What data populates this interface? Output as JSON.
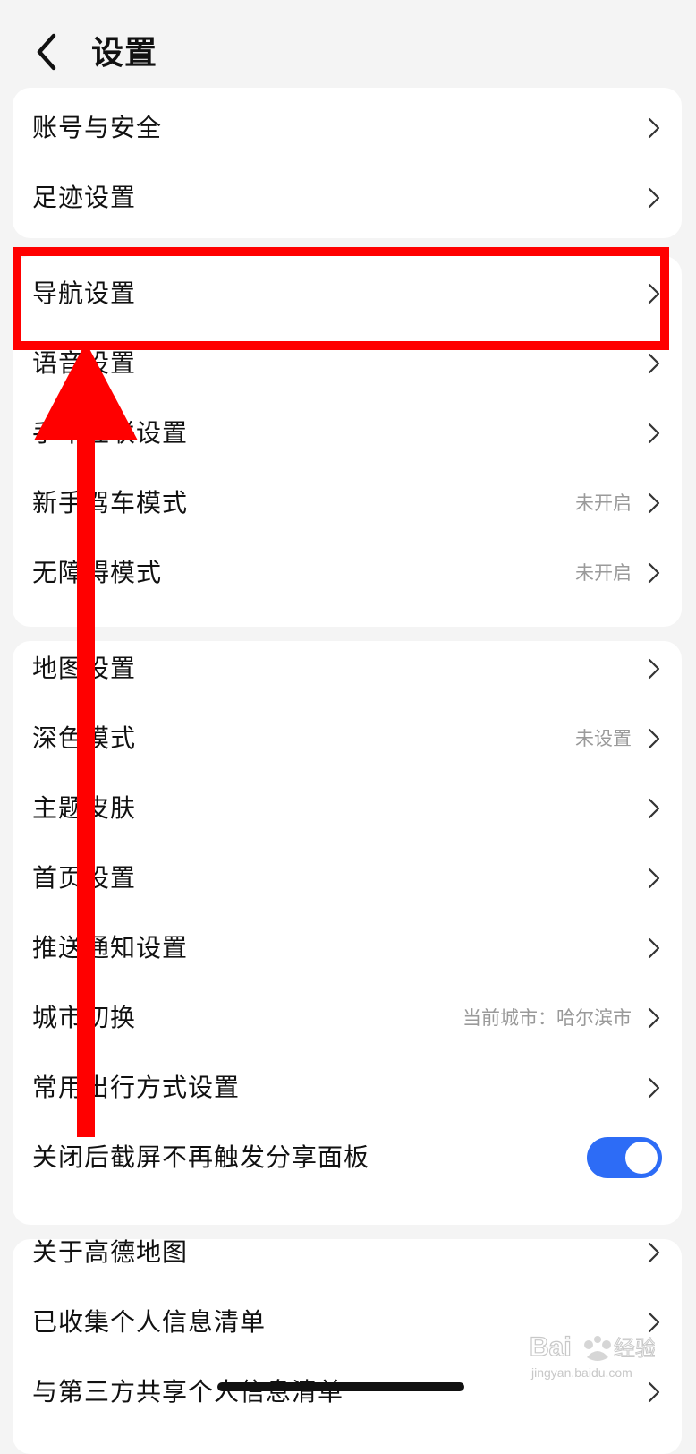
{
  "header": {
    "back_icon": "chevron-left-icon",
    "title": "设置"
  },
  "groups": [
    {
      "items": [
        {
          "label": "账号与安全",
          "value": ""
        },
        {
          "label": "足迹设置",
          "value": ""
        }
      ]
    },
    {
      "items": [
        {
          "label": "导航设置",
          "value": ""
        },
        {
          "label": "语音设置",
          "value": ""
        },
        {
          "label": "手车互联设置",
          "value": ""
        },
        {
          "label": "新手驾车模式",
          "value": "未开启"
        },
        {
          "label": "无障碍模式",
          "value": "未开启"
        }
      ]
    },
    {
      "items": [
        {
          "label": "地图设置",
          "value": ""
        },
        {
          "label": "深色模式",
          "value": "未设置"
        },
        {
          "label": "主题皮肤",
          "value": ""
        },
        {
          "label": "首页设置",
          "value": ""
        },
        {
          "label": "推送通知设置",
          "value": ""
        },
        {
          "label": "城市切换",
          "value": "当前城市：哈尔滨市"
        },
        {
          "label": "常用出行方式设置",
          "value": ""
        },
        {
          "label": "关闭后截屏不再触发分享面板",
          "toggle_on": true
        }
      ]
    },
    {
      "items": [
        {
          "label": "关于高德地图",
          "value": ""
        },
        {
          "label": "已收集个人信息清单",
          "value": ""
        },
        {
          "label": "与第三方共享个人信息清单",
          "value": ""
        }
      ]
    }
  ],
  "annotation": {
    "highlighted_item": "导航设置",
    "highlight_color": "#ff0000",
    "arrow_color": "#ff0000"
  },
  "colors": {
    "background": "#f4f4f4",
    "card": "#ffffff",
    "toggle_on": "#2d6cf6",
    "secondary_text": "#9a9a9a"
  },
  "watermark": {
    "text": "Baidu经验",
    "subtext": "jingyan.baidu.com"
  }
}
